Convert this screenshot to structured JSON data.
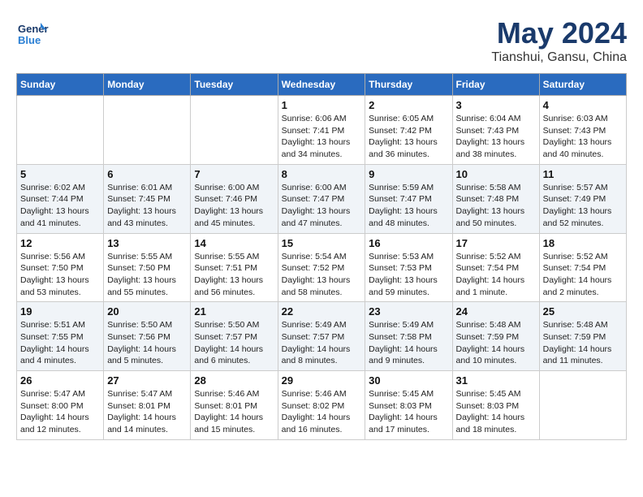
{
  "header": {
    "logo": {
      "general": "General",
      "blue": "Blue"
    },
    "title": "May 2024",
    "location": "Tianshui, Gansu, China"
  },
  "weekdays": [
    "Sunday",
    "Monday",
    "Tuesday",
    "Wednesday",
    "Thursday",
    "Friday",
    "Saturday"
  ],
  "weeks": [
    [
      {
        "day": "",
        "info": ""
      },
      {
        "day": "",
        "info": ""
      },
      {
        "day": "",
        "info": ""
      },
      {
        "day": "1",
        "info": "Sunrise: 6:06 AM\nSunset: 7:41 PM\nDaylight: 13 hours\nand 34 minutes."
      },
      {
        "day": "2",
        "info": "Sunrise: 6:05 AM\nSunset: 7:42 PM\nDaylight: 13 hours\nand 36 minutes."
      },
      {
        "day": "3",
        "info": "Sunrise: 6:04 AM\nSunset: 7:43 PM\nDaylight: 13 hours\nand 38 minutes."
      },
      {
        "day": "4",
        "info": "Sunrise: 6:03 AM\nSunset: 7:43 PM\nDaylight: 13 hours\nand 40 minutes."
      }
    ],
    [
      {
        "day": "5",
        "info": "Sunrise: 6:02 AM\nSunset: 7:44 PM\nDaylight: 13 hours\nand 41 minutes."
      },
      {
        "day": "6",
        "info": "Sunrise: 6:01 AM\nSunset: 7:45 PM\nDaylight: 13 hours\nand 43 minutes."
      },
      {
        "day": "7",
        "info": "Sunrise: 6:00 AM\nSunset: 7:46 PM\nDaylight: 13 hours\nand 45 minutes."
      },
      {
        "day": "8",
        "info": "Sunrise: 6:00 AM\nSunset: 7:47 PM\nDaylight: 13 hours\nand 47 minutes."
      },
      {
        "day": "9",
        "info": "Sunrise: 5:59 AM\nSunset: 7:47 PM\nDaylight: 13 hours\nand 48 minutes."
      },
      {
        "day": "10",
        "info": "Sunrise: 5:58 AM\nSunset: 7:48 PM\nDaylight: 13 hours\nand 50 minutes."
      },
      {
        "day": "11",
        "info": "Sunrise: 5:57 AM\nSunset: 7:49 PM\nDaylight: 13 hours\nand 52 minutes."
      }
    ],
    [
      {
        "day": "12",
        "info": "Sunrise: 5:56 AM\nSunset: 7:50 PM\nDaylight: 13 hours\nand 53 minutes."
      },
      {
        "day": "13",
        "info": "Sunrise: 5:55 AM\nSunset: 7:50 PM\nDaylight: 13 hours\nand 55 minutes."
      },
      {
        "day": "14",
        "info": "Sunrise: 5:55 AM\nSunset: 7:51 PM\nDaylight: 13 hours\nand 56 minutes."
      },
      {
        "day": "15",
        "info": "Sunrise: 5:54 AM\nSunset: 7:52 PM\nDaylight: 13 hours\nand 58 minutes."
      },
      {
        "day": "16",
        "info": "Sunrise: 5:53 AM\nSunset: 7:53 PM\nDaylight: 13 hours\nand 59 minutes."
      },
      {
        "day": "17",
        "info": "Sunrise: 5:52 AM\nSunset: 7:54 PM\nDaylight: 14 hours\nand 1 minute."
      },
      {
        "day": "18",
        "info": "Sunrise: 5:52 AM\nSunset: 7:54 PM\nDaylight: 14 hours\nand 2 minutes."
      }
    ],
    [
      {
        "day": "19",
        "info": "Sunrise: 5:51 AM\nSunset: 7:55 PM\nDaylight: 14 hours\nand 4 minutes."
      },
      {
        "day": "20",
        "info": "Sunrise: 5:50 AM\nSunset: 7:56 PM\nDaylight: 14 hours\nand 5 minutes."
      },
      {
        "day": "21",
        "info": "Sunrise: 5:50 AM\nSunset: 7:57 PM\nDaylight: 14 hours\nand 6 minutes."
      },
      {
        "day": "22",
        "info": "Sunrise: 5:49 AM\nSunset: 7:57 PM\nDaylight: 14 hours\nand 8 minutes."
      },
      {
        "day": "23",
        "info": "Sunrise: 5:49 AM\nSunset: 7:58 PM\nDaylight: 14 hours\nand 9 minutes."
      },
      {
        "day": "24",
        "info": "Sunrise: 5:48 AM\nSunset: 7:59 PM\nDaylight: 14 hours\nand 10 minutes."
      },
      {
        "day": "25",
        "info": "Sunrise: 5:48 AM\nSunset: 7:59 PM\nDaylight: 14 hours\nand 11 minutes."
      }
    ],
    [
      {
        "day": "26",
        "info": "Sunrise: 5:47 AM\nSunset: 8:00 PM\nDaylight: 14 hours\nand 12 minutes."
      },
      {
        "day": "27",
        "info": "Sunrise: 5:47 AM\nSunset: 8:01 PM\nDaylight: 14 hours\nand 14 minutes."
      },
      {
        "day": "28",
        "info": "Sunrise: 5:46 AM\nSunset: 8:01 PM\nDaylight: 14 hours\nand 15 minutes."
      },
      {
        "day": "29",
        "info": "Sunrise: 5:46 AM\nSunset: 8:02 PM\nDaylight: 14 hours\nand 16 minutes."
      },
      {
        "day": "30",
        "info": "Sunrise: 5:45 AM\nSunset: 8:03 PM\nDaylight: 14 hours\nand 17 minutes."
      },
      {
        "day": "31",
        "info": "Sunrise: 5:45 AM\nSunset: 8:03 PM\nDaylight: 14 hours\nand 18 minutes."
      },
      {
        "day": "",
        "info": ""
      }
    ]
  ]
}
